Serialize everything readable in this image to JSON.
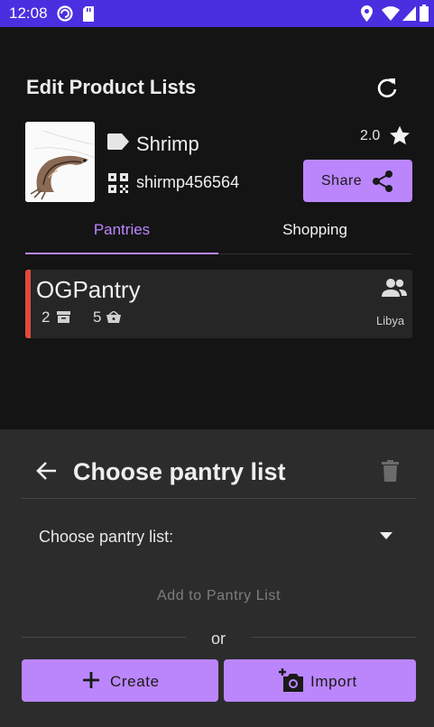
{
  "status_bar": {
    "time": "12:08"
  },
  "header": {
    "title": "Edit Product Lists"
  },
  "product": {
    "name": "Shrimp",
    "code": "shirmp456564",
    "rating": "2.0",
    "share_label": "Share"
  },
  "tabs": [
    {
      "label": "Pantries"
    },
    {
      "label": "Shopping"
    }
  ],
  "pantry_card": {
    "name": "OGPantry",
    "count_storage": "2",
    "count_items": "5",
    "country": "Libya",
    "accent_color": "#e04b3b"
  },
  "sheet": {
    "title": "Choose pantry list",
    "select_label": "Choose pantry list:",
    "add_button": "Add to Pantry List",
    "or_text": "or",
    "create_label": "Create",
    "import_label": "Import"
  },
  "colors": {
    "accent": "#bb86fc",
    "status_bar": "#4a2fe0"
  }
}
